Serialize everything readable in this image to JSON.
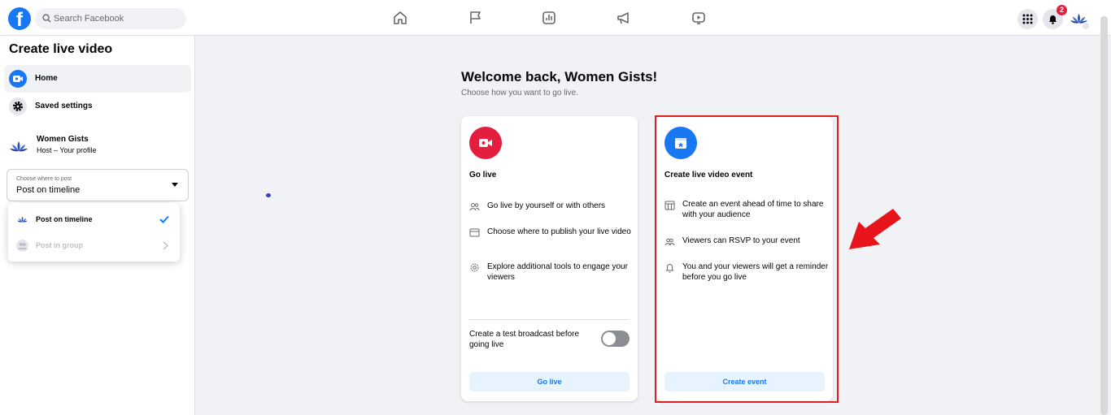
{
  "topbar": {
    "logo": "f",
    "search_placeholder": "Search Facebook",
    "notification_count": "2",
    "nav_icons": [
      "home-icon",
      "flag-icon",
      "insights-icon",
      "megaphone-icon",
      "video-icon"
    ]
  },
  "sidebar": {
    "title": "Create live video",
    "items": [
      {
        "label": "Home",
        "icon": "live-camera-icon"
      },
      {
        "label": "Saved settings",
        "icon": "gear-icon"
      }
    ],
    "profile": {
      "name": "Women Gists",
      "role": "Host – Your profile"
    },
    "select": {
      "label": "Choose where to post",
      "value": "Post on timeline"
    },
    "dropdown": [
      {
        "label": "Post on timeline",
        "selected": true
      },
      {
        "label": "Post in group",
        "disabled": true
      }
    ]
  },
  "main": {
    "welcome": "Welcome back, Women Gists!",
    "subtitle": "Choose how you want to go live.",
    "go_live_card": {
      "title": "Go live",
      "features": [
        "Go live by yourself or with others",
        "Choose where to publish your live video",
        "Explore additional tools to engage your viewers"
      ],
      "toggle_label": "Create a test broadcast before going live",
      "button": "Go live"
    },
    "event_card": {
      "title": "Create live video event",
      "features": [
        "Create an event ahead of time to share with your audience",
        "Viewers can RSVP to your event",
        "You and your viewers will get a reminder before you go live"
      ],
      "button": "Create event"
    }
  },
  "colors": {
    "brand": "#1877f2",
    "red": "#e41e3f",
    "annotation": "#e02020"
  }
}
